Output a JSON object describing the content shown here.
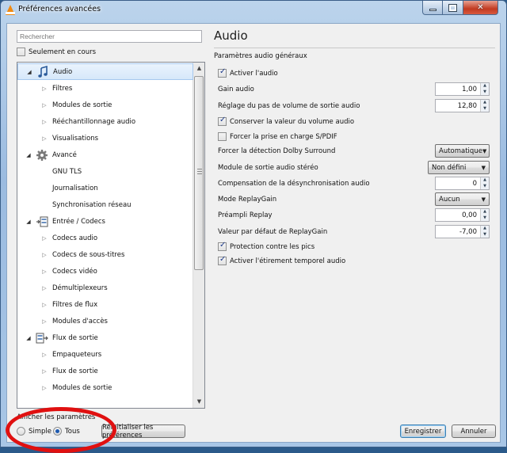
{
  "window": {
    "title": "Préférences avancées",
    "controls": {
      "minimize": "minimize",
      "maximize": "maximize",
      "close": "close"
    }
  },
  "left": {
    "search_placeholder": "Rechercher",
    "only_current_label": "Seulement en cours",
    "only_current_checked": false,
    "tree": [
      {
        "label": "Audio",
        "level": 0,
        "expander": "expanded",
        "icon": "audio-note-icon",
        "selected": true
      },
      {
        "label": "Filtres",
        "level": 1,
        "expander": "collapsed"
      },
      {
        "label": "Modules de sortie",
        "level": 1,
        "expander": "collapsed"
      },
      {
        "label": "Rééchantillonnage audio",
        "level": 1,
        "expander": "collapsed"
      },
      {
        "label": "Visualisations",
        "level": 1,
        "expander": "collapsed"
      },
      {
        "label": "Avancé",
        "level": 0,
        "expander": "expanded",
        "icon": "gear-icon"
      },
      {
        "label": "GNU TLS",
        "level": 1,
        "expander": "none"
      },
      {
        "label": "Journalisation",
        "level": 1,
        "expander": "none"
      },
      {
        "label": "Synchronisation réseau",
        "level": 1,
        "expander": "none"
      },
      {
        "label": "Entrée / Codecs",
        "level": 0,
        "expander": "expanded",
        "icon": "input-codecs-icon"
      },
      {
        "label": "Codecs audio",
        "level": 1,
        "expander": "collapsed"
      },
      {
        "label": "Codecs de sous-titres",
        "level": 1,
        "expander": "collapsed"
      },
      {
        "label": "Codecs vidéo",
        "level": 1,
        "expander": "collapsed"
      },
      {
        "label": "Démultiplexeurs",
        "level": 1,
        "expander": "collapsed"
      },
      {
        "label": "Filtres de flux",
        "level": 1,
        "expander": "collapsed"
      },
      {
        "label": "Modules d'accès",
        "level": 1,
        "expander": "collapsed"
      },
      {
        "label": "Flux de sortie",
        "level": 0,
        "expander": "expanded",
        "icon": "stream-output-icon"
      },
      {
        "label": "Empaqueteurs",
        "level": 1,
        "expander": "collapsed"
      },
      {
        "label": "Flux de sortie",
        "level": 1,
        "expander": "collapsed"
      },
      {
        "label": "Modules de sortie",
        "level": 1,
        "expander": "collapsed"
      }
    ],
    "show_settings_label": "Afficher les paramètres",
    "radio_simple": "Simple",
    "radio_all": "Tous",
    "reset_button": "Réinitialiser les préférences"
  },
  "right": {
    "title": "Audio",
    "subtitle": "Paramètres audio généraux",
    "rows": [
      {
        "type": "checkbox",
        "label": "Activer l'audio",
        "checked": true
      },
      {
        "type": "spin",
        "label": "Gain audio",
        "value": "1,00"
      },
      {
        "type": "spin",
        "label": "Réglage du pas de volume de sortie audio",
        "value": "12,80"
      },
      {
        "type": "checkbox",
        "label": "Conserver la valeur du volume audio",
        "checked": true
      },
      {
        "type": "checkbox",
        "label": "Forcer la prise en charge S/PDIF",
        "checked": false
      },
      {
        "type": "combo",
        "label": "Forcer la détection Dolby Surround",
        "value": "Automatique"
      },
      {
        "type": "combo",
        "label": "Module de sortie audio stéréo",
        "value": "Non défini"
      },
      {
        "type": "spin",
        "label": "Compensation de la désynchronisation audio",
        "value": "0"
      },
      {
        "type": "combo",
        "label": "Mode ReplayGain",
        "value": "Aucun"
      },
      {
        "type": "spin",
        "label": "Préampli Replay",
        "value": "0,00"
      },
      {
        "type": "spin",
        "label": "Valeur par défaut de ReplayGain",
        "value": "-7,00"
      },
      {
        "type": "checkbox",
        "label": "Protection contre les pics",
        "checked": true
      },
      {
        "type": "checkbox",
        "label": "Activer l'étirement temporel audio",
        "checked": true
      }
    ]
  },
  "buttons": {
    "save": "Enregistrer",
    "cancel": "Annuler"
  },
  "colors": {
    "annotation_circle": "#e01010",
    "selection": "#d6e8fa",
    "title_accent": "#9bbbe0"
  }
}
